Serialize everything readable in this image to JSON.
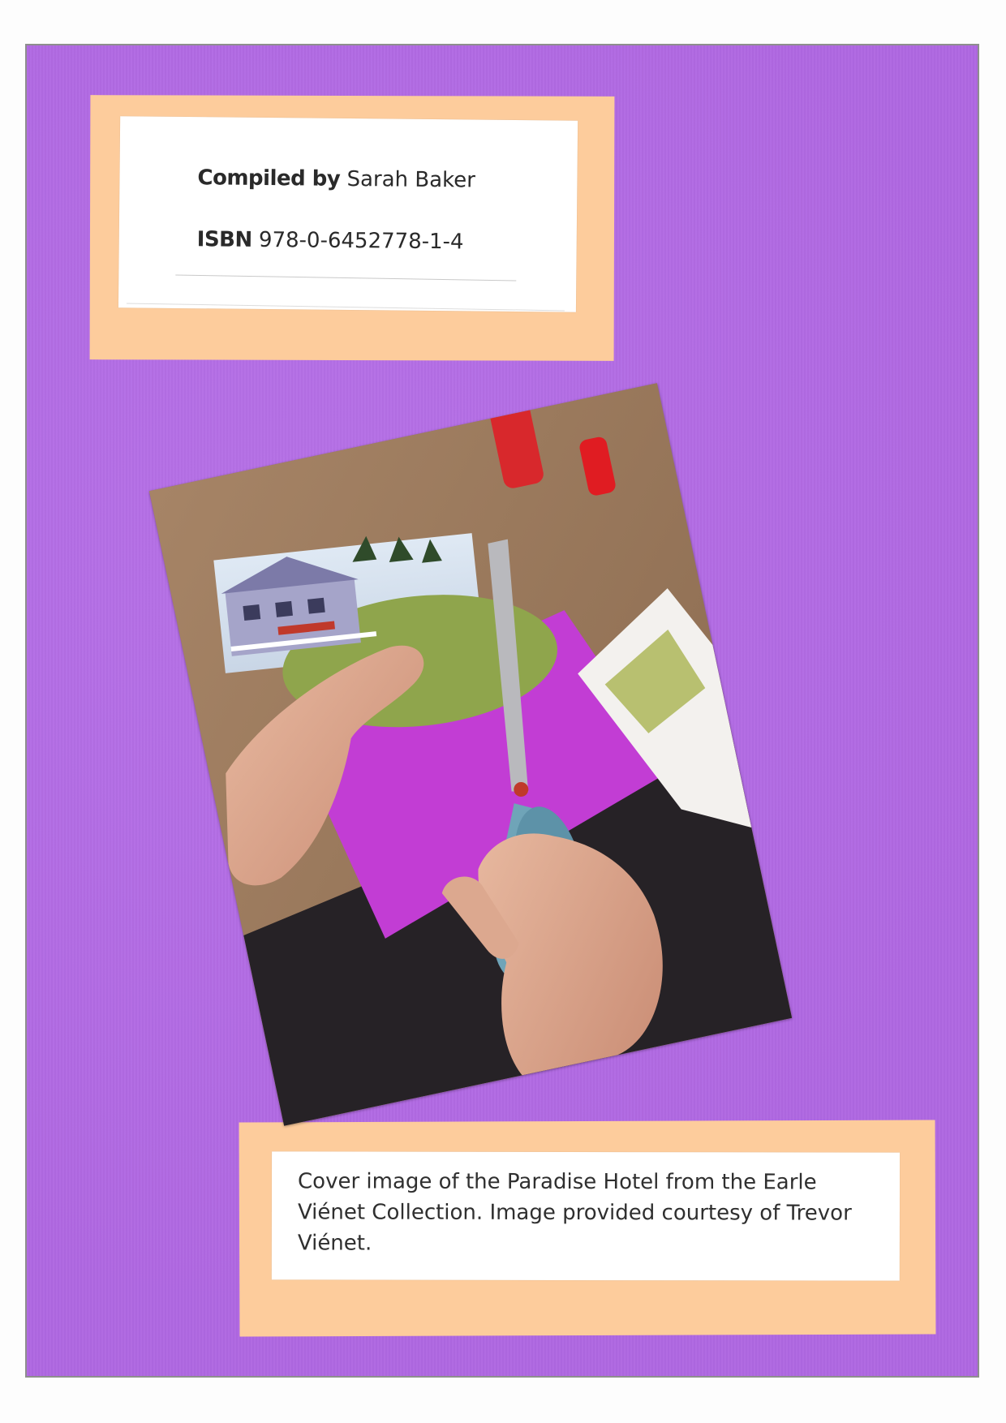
{
  "credits": {
    "compiled_label": "Compiled by",
    "compiler": "Sarah Baker",
    "isbn_label": "ISBN",
    "isbn": "978-0-6452778-1-4"
  },
  "caption": {
    "text": "Cover image of the Paradise Hotel from the Earle Viénet Collection. Image provided courtesy of Trevor Viénet."
  },
  "colors": {
    "sheet": "#b36ae6",
    "peach_card": "#fdcc9c",
    "label": "#ffffff",
    "table_surface": "#9b7a5d",
    "magenta_paper": "#c23dd4",
    "scissors_handle": "#6fa4b8"
  },
  "photo": {
    "subject": "hands cutting a photograph of the Paradise Hotel with scissors"
  }
}
